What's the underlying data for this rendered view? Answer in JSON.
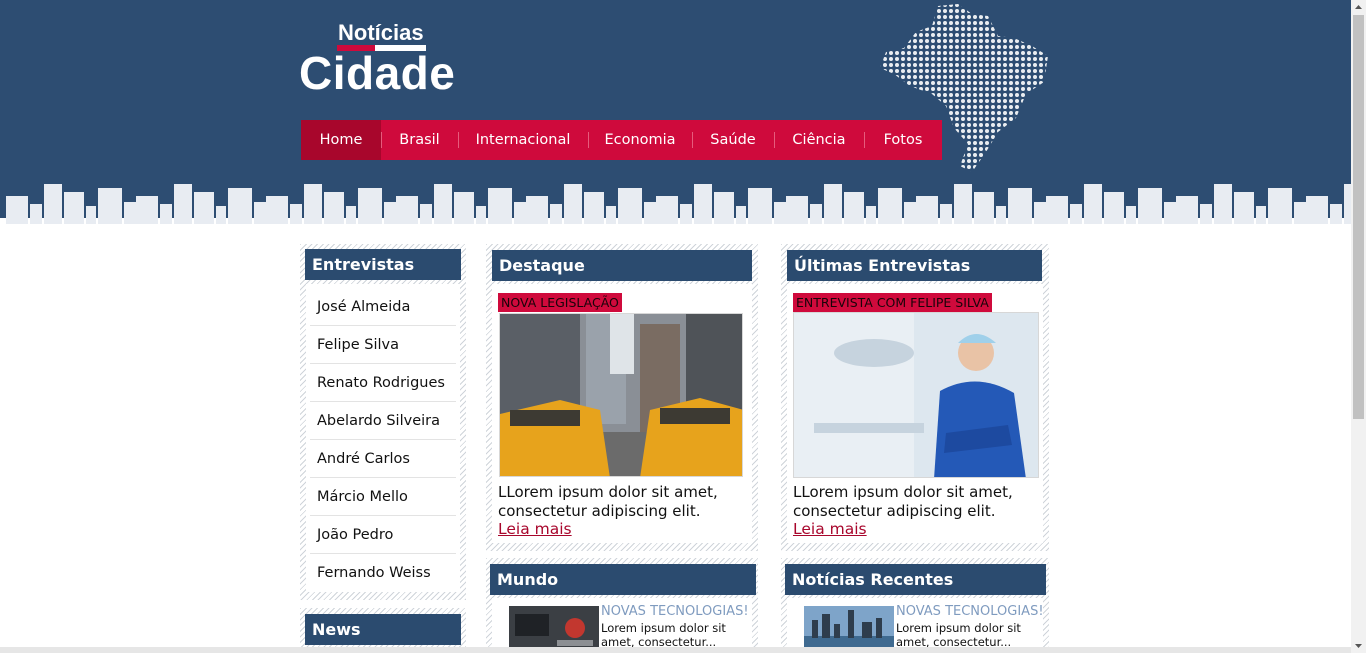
{
  "logo": {
    "top": "Notícias",
    "main": "Cidade"
  },
  "nav": [
    {
      "label": "Home",
      "active": true
    },
    {
      "label": "Brasil"
    },
    {
      "label": "Internacional"
    },
    {
      "label": "Economia"
    },
    {
      "label": "Saúde"
    },
    {
      "label": "Ciência"
    },
    {
      "label": "Fotos"
    }
  ],
  "sidebar": {
    "entrevistas_title": "Entrevistas",
    "items": [
      "José Almeida",
      "Felipe Silva",
      "Renato Rodrigues",
      "Abelardo Silveira",
      "André Carlos",
      "Márcio Mello",
      "João Pedro",
      "Fernando Weiss"
    ],
    "news_title": "News"
  },
  "destaque": {
    "title": "Destaque",
    "tag": "NOVA LEGISLAÇÃO",
    "text": "LLorem ipsum dolor sit amet, consectetur adipiscing elit.",
    "more": "Leia mais"
  },
  "ultimas": {
    "title": "Últimas Entrevistas",
    "tag": "ENTREVISTA COM FELIPE SILVA",
    "text": "LLorem ipsum dolor sit amet, consectetur adipiscing elit.",
    "more": "Leia mais"
  },
  "mundo": {
    "title": "Mundo",
    "item_title": "NOVAS TECNOLOGIAS!",
    "item_text": "Lorem ipsum dolor sit amet, consectetur..."
  },
  "recentes": {
    "title": "Notícias Recentes",
    "item_title": "NOVAS TECNOLOGIAS!",
    "item_text": "Lorem ipsum dolor sit amet, consectetur..."
  },
  "colors": {
    "header_bg": "#2d4d72",
    "accent": "#cf0a3c",
    "title_bar": "#2b4b6f",
    "link": "#a8062c"
  }
}
